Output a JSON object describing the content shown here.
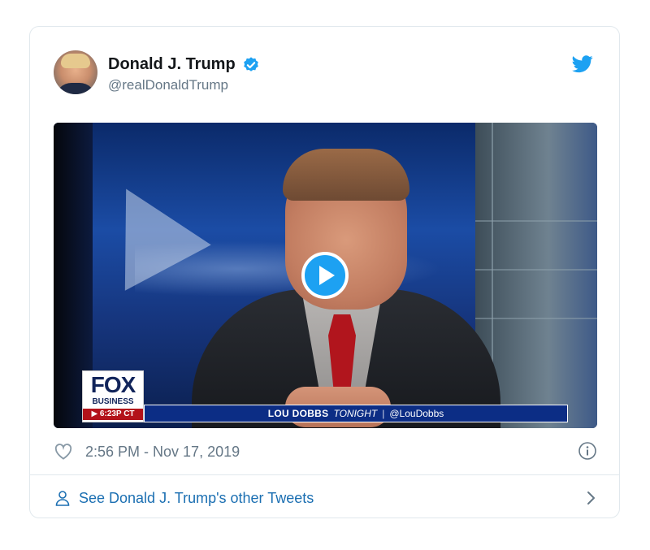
{
  "tweet": {
    "author_name": "Donald J. Trump",
    "author_handle": "@realDonaldTrump",
    "verified": true,
    "timestamp": "2:56 PM - Nov 17, 2019",
    "other_tweets_link": "See Donald J. Trump's other Tweets"
  },
  "video": {
    "network_logo": "FOX",
    "network_sub": "BUSINESS",
    "air_time": "▶ 6:23P CT",
    "show_name": "LOU DOBBS",
    "show_suffix": "TONIGHT",
    "show_handle": "@LouDobbs"
  },
  "icons": {
    "verified": "verified-badge-icon",
    "brand": "twitter-bird-icon",
    "like": "heart-icon",
    "info": "info-icon",
    "profile": "person-icon",
    "next": "chevron-right-icon",
    "play": "play-icon"
  },
  "colors": {
    "accent": "#1da1f2",
    "link": "#1b6fb2",
    "muted": "#657786",
    "border": "#e1e8ed"
  }
}
